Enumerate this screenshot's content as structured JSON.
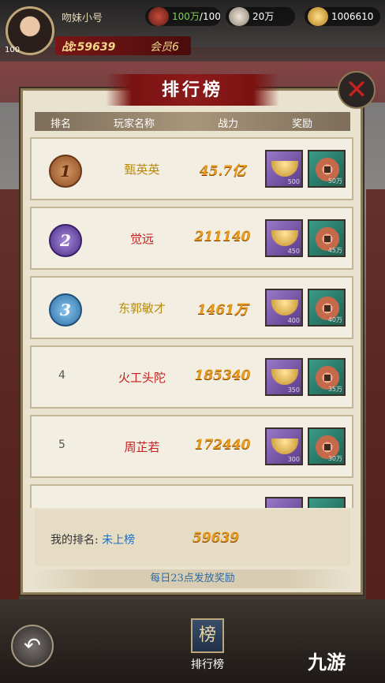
{
  "hud": {
    "player_name": "吻妹小号",
    "level": "100",
    "power_label": "战:59639",
    "vip_label": "会员6",
    "resources": [
      {
        "icon": "stamina-icon",
        "value": "100万",
        "max": "/100"
      },
      {
        "icon": "skull-token-icon",
        "value": "20万"
      },
      {
        "icon": "gold-ingot-icon",
        "value": "1006610"
      }
    ]
  },
  "panel": {
    "title": "排行榜",
    "headers": {
      "rank": "排名",
      "player": "玩家名称",
      "power": "战力",
      "reward": "奖励"
    },
    "rows": [
      {
        "rank": "1",
        "name": "甄英英",
        "power": "45.7亿",
        "name_color": "#b58a12",
        "ingot_qty": "500",
        "coin_qty": "50万"
      },
      {
        "rank": "2",
        "name": "觉远",
        "power": "211140",
        "name_color": "#c21e1e",
        "ingot_qty": "450",
        "coin_qty": "45万"
      },
      {
        "rank": "3",
        "name": "东郭敏才",
        "power": "1461万",
        "name_color": "#b58a12",
        "ingot_qty": "400",
        "coin_qty": "40万"
      },
      {
        "rank": "4",
        "name": "火工头陀",
        "power": "185340",
        "name_color": "#c21e1e",
        "ingot_qty": "350",
        "coin_qty": "35万"
      },
      {
        "rank": "5",
        "name": "周芷若",
        "power": "172440",
        "name_color": "#c21e1e",
        "ingot_qty": "300",
        "coin_qty": "30万"
      }
    ],
    "my_rank_label": "我的排名:",
    "my_rank_value": "未上榜",
    "my_power": "59639",
    "footer_note": "每日23点发放奖励"
  },
  "bottom": {
    "rank_tab_icon": "榜",
    "rank_tab_label": "排行榜",
    "watermark": "九游"
  }
}
